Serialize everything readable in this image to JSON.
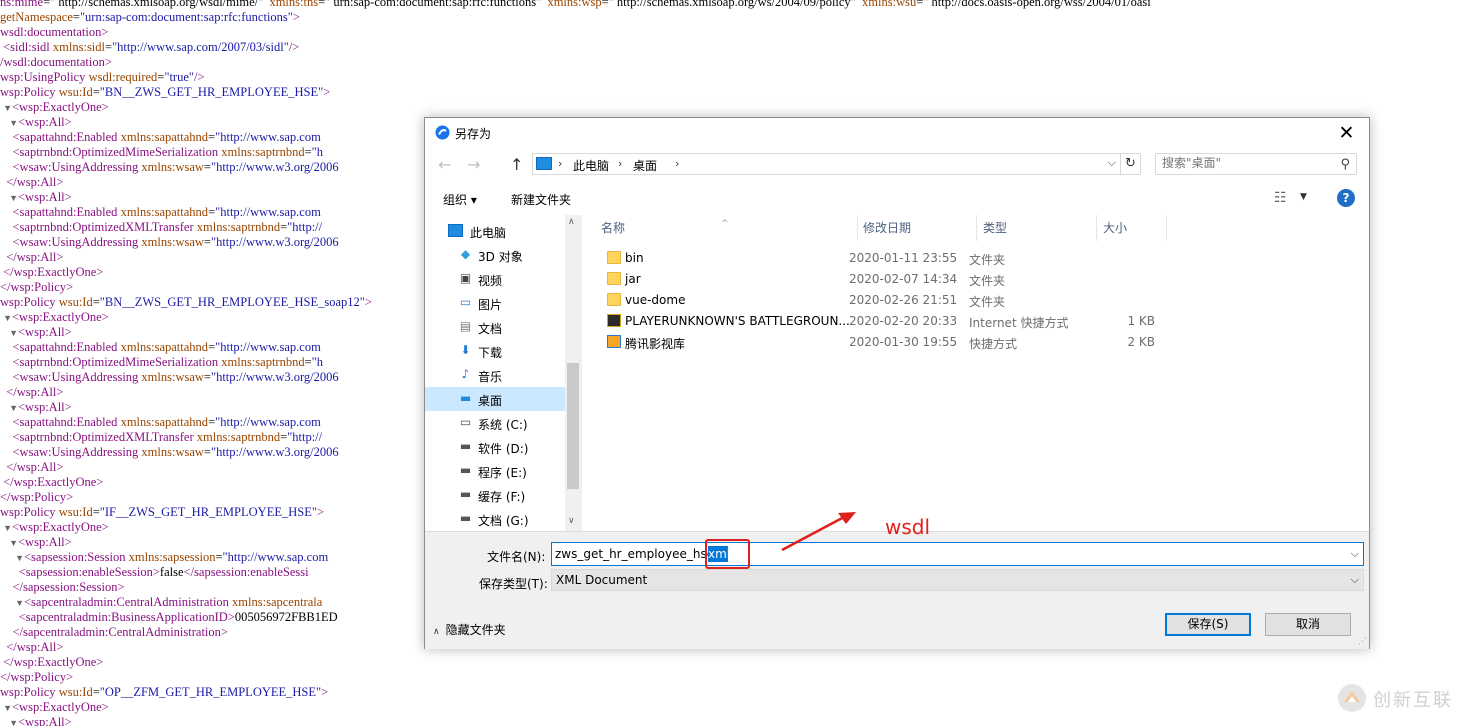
{
  "xml_lines": [
    {
      "tw": "",
      "parts": [
        {
          "c": "tg",
          "t": "ns:mime"
        },
        {
          "c": "tx",
          "t": "=\" http://schemas.xmlsoap.org/wsdl/mime/\"  "
        },
        {
          "c": "an",
          "t": "xmlns:tns"
        },
        {
          "c": "tx",
          "t": "=\" urn:sap-com:document:sap:rfc:functions\"  "
        },
        {
          "c": "an",
          "t": "xmlns:wsp"
        },
        {
          "c": "tx",
          "t": "=\" http://schemas.xmlsoap.org/ws/2004/09/policy\"  "
        },
        {
          "c": "an",
          "t": "xmlns:wsu"
        },
        {
          "c": "tx",
          "t": "=\" http://docs.oasis-open.org/wss/2004/01/oasi"
        }
      ]
    },
    {
      "tw": "",
      "parts": [
        {
          "c": "an",
          "t": "getNamespace"
        },
        {
          "c": "tx",
          "t": "="
        },
        {
          "c": "av",
          "t": "\"urn:sap-com:document:sap:rfc:functions\""
        },
        {
          "c": "tg",
          "t": ">"
        }
      ]
    },
    {
      "tw": "",
      "parts": [
        {
          "c": "tg",
          "t": "wsdl:documentation>"
        }
      ]
    },
    {
      "tw": "",
      "parts": [
        {
          "c": "tg",
          "t": " <sidl:sidl "
        },
        {
          "c": "an",
          "t": "xmlns:sidl"
        },
        {
          "c": "tx",
          "t": "="
        },
        {
          "c": "av",
          "t": "\"http://www.sap.com/2007/03/sidl\""
        },
        {
          "c": "tg",
          "t": "/>"
        }
      ]
    },
    {
      "tw": "",
      "parts": [
        {
          "c": "tg",
          "t": "/wsdl:documentation>"
        }
      ]
    },
    {
      "tw": "",
      "parts": [
        {
          "c": "tg",
          "t": "wsp:UsingPolicy "
        },
        {
          "c": "an",
          "t": "wsdl:required"
        },
        {
          "c": "tx",
          "t": "="
        },
        {
          "c": "av",
          "t": "\"true\""
        },
        {
          "c": "tg",
          "t": "/>"
        }
      ]
    },
    {
      "tw": "",
      "parts": [
        {
          "c": "tg",
          "t": "wsp:Policy "
        },
        {
          "c": "an",
          "t": "wsu:Id"
        },
        {
          "c": "tx",
          "t": "="
        },
        {
          "c": "av",
          "t": "\"BN__ZWS_GET_HR_EMPLOYEE_HSE\""
        },
        {
          "c": "tg",
          "t": ">"
        }
      ]
    },
    {
      "tw": "▼",
      "parts": [
        {
          "c": "tg",
          "t": "<wsp:ExactlyOne>"
        }
      ]
    },
    {
      "tw": " ▼",
      "parts": [
        {
          "c": "tg",
          "t": "<wsp:All>"
        }
      ]
    },
    {
      "tw": "",
      "parts": [
        {
          "c": "tg",
          "t": "    <sapattahnd:Enabled "
        },
        {
          "c": "an",
          "t": "xmlns:sapattahnd"
        },
        {
          "c": "tx",
          "t": "="
        },
        {
          "c": "av",
          "t": "\"http://www.sap.com"
        }
      ]
    },
    {
      "tw": "",
      "parts": [
        {
          "c": "tg",
          "t": "    <saptrnbnd:OptimizedMimeSerialization "
        },
        {
          "c": "an",
          "t": "xmlns:saptrnbnd"
        },
        {
          "c": "tx",
          "t": "="
        },
        {
          "c": "av",
          "t": "\"h"
        }
      ]
    },
    {
      "tw": "",
      "parts": [
        {
          "c": "tg",
          "t": "    <wsaw:UsingAddressing "
        },
        {
          "c": "an",
          "t": "xmlns:wsaw"
        },
        {
          "c": "tx",
          "t": "="
        },
        {
          "c": "av",
          "t": "\"http://www.w3.org/2006"
        }
      ]
    },
    {
      "tw": "",
      "parts": [
        {
          "c": "tg",
          "t": "  </wsp:All>"
        }
      ]
    },
    {
      "tw": " ▼",
      "parts": [
        {
          "c": "tg",
          "t": "<wsp:All>"
        }
      ]
    },
    {
      "tw": "",
      "parts": [
        {
          "c": "tg",
          "t": "    <sapattahnd:Enabled "
        },
        {
          "c": "an",
          "t": "xmlns:sapattahnd"
        },
        {
          "c": "tx",
          "t": "="
        },
        {
          "c": "av",
          "t": "\"http://www.sap.com"
        }
      ]
    },
    {
      "tw": "",
      "parts": [
        {
          "c": "tg",
          "t": "    <saptrnbnd:OptimizedXMLTransfer "
        },
        {
          "c": "an",
          "t": "xmlns:saptrnbnd"
        },
        {
          "c": "tx",
          "t": "="
        },
        {
          "c": "av",
          "t": "\"http://"
        }
      ]
    },
    {
      "tw": "",
      "parts": [
        {
          "c": "tg",
          "t": "    <wsaw:UsingAddressing "
        },
        {
          "c": "an",
          "t": "xmlns:wsaw"
        },
        {
          "c": "tx",
          "t": "="
        },
        {
          "c": "av",
          "t": "\"http://www.w3.org/2006"
        }
      ]
    },
    {
      "tw": "",
      "parts": [
        {
          "c": "tg",
          "t": "  </wsp:All>"
        }
      ]
    },
    {
      "tw": "",
      "parts": [
        {
          "c": "tg",
          "t": " </wsp:ExactlyOne>"
        }
      ]
    },
    {
      "tw": "",
      "parts": [
        {
          "c": "tg",
          "t": "</wsp:Policy>"
        }
      ]
    },
    {
      "tw": "",
      "parts": [
        {
          "c": "tg",
          "t": "wsp:Policy "
        },
        {
          "c": "an",
          "t": "wsu:Id"
        },
        {
          "c": "tx",
          "t": "="
        },
        {
          "c": "av",
          "t": "\"BN__ZWS_GET_HR_EMPLOYEE_HSE_soap12\""
        },
        {
          "c": "tg",
          "t": ">"
        }
      ]
    },
    {
      "tw": "▼",
      "parts": [
        {
          "c": "tg",
          "t": "<wsp:ExactlyOne>"
        }
      ]
    },
    {
      "tw": " ▼",
      "parts": [
        {
          "c": "tg",
          "t": "<wsp:All>"
        }
      ]
    },
    {
      "tw": "",
      "parts": [
        {
          "c": "tg",
          "t": "    <sapattahnd:Enabled "
        },
        {
          "c": "an",
          "t": "xmlns:sapattahnd"
        },
        {
          "c": "tx",
          "t": "="
        },
        {
          "c": "av",
          "t": "\"http://www.sap.com"
        }
      ]
    },
    {
      "tw": "",
      "parts": [
        {
          "c": "tg",
          "t": "    <saptrnbnd:OptimizedMimeSerialization "
        },
        {
          "c": "an",
          "t": "xmlns:saptrnbnd"
        },
        {
          "c": "tx",
          "t": "="
        },
        {
          "c": "av",
          "t": "\"h"
        }
      ]
    },
    {
      "tw": "",
      "parts": [
        {
          "c": "tg",
          "t": "    <wsaw:UsingAddressing "
        },
        {
          "c": "an",
          "t": "xmlns:wsaw"
        },
        {
          "c": "tx",
          "t": "="
        },
        {
          "c": "av",
          "t": "\"http://www.w3.org/2006"
        }
      ]
    },
    {
      "tw": "",
      "parts": [
        {
          "c": "tg",
          "t": "  </wsp:All>"
        }
      ]
    },
    {
      "tw": " ▼",
      "parts": [
        {
          "c": "tg",
          "t": "<wsp:All>"
        }
      ]
    },
    {
      "tw": "",
      "parts": [
        {
          "c": "tg",
          "t": "    <sapattahnd:Enabled "
        },
        {
          "c": "an",
          "t": "xmlns:sapattahnd"
        },
        {
          "c": "tx",
          "t": "="
        },
        {
          "c": "av",
          "t": "\"http://www.sap.com"
        }
      ]
    },
    {
      "tw": "",
      "parts": [
        {
          "c": "tg",
          "t": "    <saptrnbnd:OptimizedXMLTransfer "
        },
        {
          "c": "an",
          "t": "xmlns:saptrnbnd"
        },
        {
          "c": "tx",
          "t": "="
        },
        {
          "c": "av",
          "t": "\"http://"
        }
      ]
    },
    {
      "tw": "",
      "parts": [
        {
          "c": "tg",
          "t": "    <wsaw:UsingAddressing "
        },
        {
          "c": "an",
          "t": "xmlns:wsaw"
        },
        {
          "c": "tx",
          "t": "="
        },
        {
          "c": "av",
          "t": "\"http://www.w3.org/2006"
        }
      ]
    },
    {
      "tw": "",
      "parts": [
        {
          "c": "tg",
          "t": "  </wsp:All>"
        }
      ]
    },
    {
      "tw": "",
      "parts": [
        {
          "c": "tg",
          "t": " </wsp:ExactlyOne>"
        }
      ]
    },
    {
      "tw": "",
      "parts": [
        {
          "c": "tg",
          "t": "</wsp:Policy>"
        }
      ]
    },
    {
      "tw": "",
      "parts": [
        {
          "c": "tg",
          "t": "wsp:Policy "
        },
        {
          "c": "an",
          "t": "wsu:Id"
        },
        {
          "c": "tx",
          "t": "="
        },
        {
          "c": "av",
          "t": "\"IF__ZWS_GET_HR_EMPLOYEE_HSE\""
        },
        {
          "c": "tg",
          "t": ">"
        }
      ]
    },
    {
      "tw": "▼",
      "parts": [
        {
          "c": "tg",
          "t": "<wsp:ExactlyOne>"
        }
      ]
    },
    {
      "tw": " ▼",
      "parts": [
        {
          "c": "tg",
          "t": "<wsp:All>"
        }
      ]
    },
    {
      "tw": "  ▼",
      "parts": [
        {
          "c": "tg",
          "t": "<sapsession:Session "
        },
        {
          "c": "an",
          "t": "xmlns:sapsession"
        },
        {
          "c": "tx",
          "t": "="
        },
        {
          "c": "av",
          "t": "\"http://www.sap.com"
        }
      ]
    },
    {
      "tw": "",
      "parts": [
        {
          "c": "tg",
          "t": "      <sapsession:enableSession>"
        },
        {
          "c": "tx",
          "t": "false"
        },
        {
          "c": "tg",
          "t": "</sapsession:enableSessi"
        }
      ]
    },
    {
      "tw": "",
      "parts": [
        {
          "c": "tg",
          "t": "    </sapsession:Session>"
        }
      ]
    },
    {
      "tw": "  ▼",
      "parts": [
        {
          "c": "tg",
          "t": "<sapcentraladmin:CentralAdministration "
        },
        {
          "c": "an",
          "t": "xmlns:sapcentrala"
        }
      ]
    },
    {
      "tw": "",
      "parts": [
        {
          "c": "tg",
          "t": "      <sapcentraladmin:BusinessApplicationID>"
        },
        {
          "c": "tx",
          "t": "005056972FBB1ED"
        }
      ]
    },
    {
      "tw": "",
      "parts": [
        {
          "c": "tg",
          "t": "    </sapcentraladmin:CentralAdministration>"
        }
      ]
    },
    {
      "tw": "",
      "parts": [
        {
          "c": "tg",
          "t": "  </wsp:All>"
        }
      ]
    },
    {
      "tw": "",
      "parts": [
        {
          "c": "tg",
          "t": " </wsp:ExactlyOne>"
        }
      ]
    },
    {
      "tw": "",
      "parts": [
        {
          "c": "tg",
          "t": "</wsp:Policy>"
        }
      ]
    },
    {
      "tw": "",
      "parts": [
        {
          "c": "tg",
          "t": "wsp:Policy "
        },
        {
          "c": "an",
          "t": "wsu:Id"
        },
        {
          "c": "tx",
          "t": "="
        },
        {
          "c": "av",
          "t": "\"OP__ZFM_GET_HR_EMPLOYEE_HSE\""
        },
        {
          "c": "tg",
          "t": ">"
        }
      ]
    },
    {
      "tw": "▼",
      "parts": [
        {
          "c": "tg",
          "t": "<wsp:ExactlyOne>"
        }
      ]
    },
    {
      "tw": " ▼",
      "parts": [
        {
          "c": "tg",
          "t": "<wsp:All>"
        }
      ]
    }
  ],
  "dialog": {
    "title": "另存为",
    "close_glyph": "✕",
    "nav": {
      "back_glyph": "←",
      "forward_glyph": "→",
      "up_glyph": "↑"
    },
    "address": {
      "crumbs": [
        "此电脑",
        "桌面"
      ],
      "sep_glyph": "›",
      "dropdown_glyph": "⌵",
      "refresh_glyph": "↻"
    },
    "search": {
      "placeholder": "搜索\"桌面\"",
      "icon_glyph": "⚲"
    },
    "toolbar": {
      "organize": "组织 ▾",
      "new_folder": "新建文件夹",
      "view_glyph": "☷",
      "view_dd_glyph": "▼",
      "help_glyph": "?"
    },
    "nav_pane": [
      {
        "label": "此电脑",
        "icon": "computer-icon",
        "glyph": "",
        "color": "#1e8ce0"
      },
      {
        "label": "3D 对象",
        "icon": "cube-icon",
        "glyph": "◆",
        "color": "#2aa1e0"
      },
      {
        "label": "视频",
        "icon": "video-icon",
        "glyph": "▣",
        "color": "#444444"
      },
      {
        "label": "图片",
        "icon": "picture-icon",
        "glyph": "▭",
        "color": "#3a7bc8"
      },
      {
        "label": "文档",
        "icon": "document-icon",
        "glyph": "▤",
        "color": "#7a7a7a"
      },
      {
        "label": "下载",
        "icon": "download-icon",
        "glyph": "⬇",
        "color": "#1e78d6"
      },
      {
        "label": "音乐",
        "icon": "music-icon",
        "glyph": "♪",
        "color": "#1e78d6"
      },
      {
        "label": "桌面",
        "icon": "desktop-icon",
        "glyph": "▬",
        "color": "#1e8ce0"
      },
      {
        "label": "系统 (C:)",
        "icon": "drive-icon",
        "glyph": "▭",
        "color": "#555555"
      },
      {
        "label": "软件 (D:)",
        "icon": "drive-icon",
        "glyph": "▬",
        "color": "#555555"
      },
      {
        "label": "程序 (E:)",
        "icon": "drive-icon",
        "glyph": "▬",
        "color": "#555555"
      },
      {
        "label": "缓存 (F:)",
        "icon": "drive-icon",
        "glyph": "▬",
        "color": "#555555"
      },
      {
        "label": "文档 (G:)",
        "icon": "drive-icon",
        "glyph": "▬",
        "color": "#555555"
      }
    ],
    "nav_selected_index": 7,
    "nav_scroll": {
      "up_glyph": "∧",
      "down_glyph": "∨"
    },
    "columns": [
      "名称",
      "修改日期",
      "类型",
      "大小"
    ],
    "sort_glyph": "^",
    "files": [
      {
        "name": "bin",
        "date": "2020-01-11 23:55",
        "type": "文件夹",
        "size": "",
        "icon": "folder-icon"
      },
      {
        "name": "jar",
        "date": "2020-02-07 14:34",
        "type": "文件夹",
        "size": "",
        "icon": "folder-icon"
      },
      {
        "name": "vue-dome",
        "date": "2020-02-26 21:51",
        "type": "文件夹",
        "size": "",
        "icon": "folder-icon"
      },
      {
        "name": "PLAYERUNKNOWN'S BATTLEGROUN...",
        "date": "2020-02-20 20:33",
        "type": "Internet 快捷方式",
        "size": "1 KB",
        "icon": "game-shortcut-icon"
      },
      {
        "name": "腾讯影视库",
        "date": "2020-01-30 19:55",
        "type": "快捷方式",
        "size": "2 KB",
        "icon": "shortcut-icon"
      }
    ],
    "filename": {
      "label": "文件名(N):",
      "value_prefix": "zws_get_hr_employee_hse.",
      "value_selected": "xml",
      "dropdown_glyph": "⌵"
    },
    "filetype": {
      "label": "保存类型(T):",
      "value": "XML Document",
      "dropdown_glyph": "⌵"
    },
    "hide_folders": {
      "chevron": "∧",
      "label": "隐藏文件夹"
    },
    "buttons": {
      "save": "保存(S)",
      "cancel": "取消"
    },
    "grip_glyph": "⋰"
  },
  "annotation": {
    "text": "wsdl",
    "color": "#e0201c"
  },
  "watermark": {
    "text": "创新互联"
  }
}
